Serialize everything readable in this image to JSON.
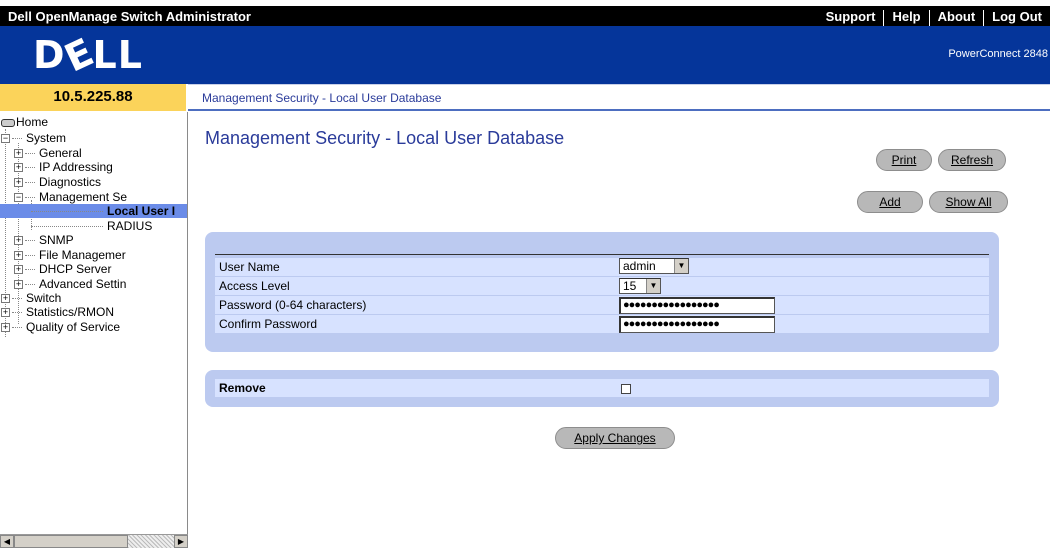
{
  "topbar": {
    "title": "Dell OpenManage Switch Administrator",
    "nav": [
      "Support",
      "Help",
      "About",
      "Log Out"
    ]
  },
  "header": {
    "logo": "DELL",
    "product": "PowerConnect 2848"
  },
  "ip_address": "10.5.225.88",
  "breadcrumb": "Management Security - Local User Database",
  "tree": {
    "home": "Home",
    "system": "System",
    "general": "General",
    "ip_addressing": "IP Addressing",
    "diagnostics": "Diagnostics",
    "management_security": "Management Se",
    "local_user": "Local User I",
    "radius": "RADIUS",
    "snmp": "SNMP",
    "file_management": "File Managemer",
    "dhcp_server": "DHCP Server",
    "advanced_settings": "Advanced Settin",
    "switch": "Switch",
    "statistics": "Statistics/RMON",
    "qos": "Quality of Service"
  },
  "main": {
    "title": "Management Security - Local User Database",
    "buttons": {
      "print": "Print",
      "refresh": "Refresh",
      "add": "Add",
      "show_all": "Show All",
      "apply": "Apply Changes"
    },
    "form": {
      "user_name_label": "User Name",
      "user_name_value": "admin",
      "access_level_label": "Access Level",
      "access_level_value": "15",
      "password_label": "Password (0-64 characters)",
      "password_value": "●●●●●●●●●●●●●●●●●",
      "confirm_label": "Confirm Password",
      "confirm_value": "●●●●●●●●●●●●●●●●●"
    },
    "remove_label": "Remove",
    "remove_checked": false
  },
  "colors": {
    "topbar": "#000000",
    "header": "#05359a",
    "ip_bar": "#fbd35a",
    "panel": "#bccaf0",
    "row": "#d7e2ff",
    "title_text": "#2a3b9a",
    "selected": "#6b8ce8"
  }
}
